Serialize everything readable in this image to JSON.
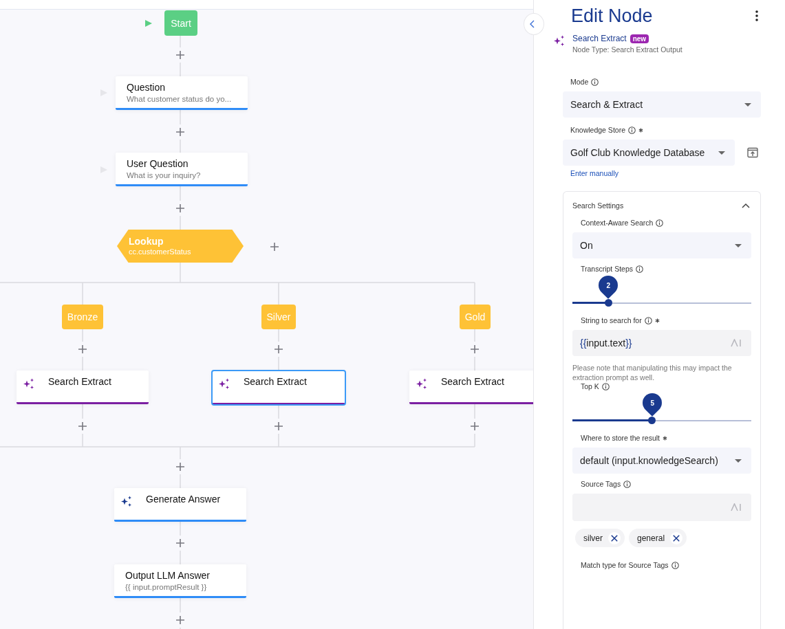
{
  "flow": {
    "nodes": [
      {
        "kind": "start",
        "label": "Start"
      },
      {
        "kind": "card",
        "title": "Question",
        "subtitle": "What customer status do yo...",
        "selected": false,
        "color": "#2f8cf7"
      },
      {
        "kind": "card",
        "title": "User Question",
        "subtitle": "What is your inquiry?",
        "selected": false,
        "color": "#2f8cf7"
      },
      {
        "kind": "lookup",
        "title": "Lookup",
        "subtitle": "cc.customerStatus"
      },
      {
        "kind": "branch",
        "label": "Bronze"
      },
      {
        "kind": "branch",
        "label": "Silver"
      },
      {
        "kind": "branch",
        "label": "Gold"
      },
      {
        "kind": "ai-card",
        "title": "Search Extract",
        "selected": false,
        "color": "#7b1fa2"
      },
      {
        "kind": "ai-card",
        "title": "Search Extract",
        "selected": true,
        "color": "#7b1fa2"
      },
      {
        "kind": "ai-card",
        "title": "Search Extract",
        "selected": false,
        "color": "#7b1fa2"
      },
      {
        "kind": "ai-card",
        "title": "Generate Answer",
        "selected": false,
        "color": "#2f8cf7"
      },
      {
        "kind": "card",
        "title": "Output LLM Answer",
        "subtitle": "{{ input.promptResult }}",
        "selected": false,
        "color": "#2f8cf7"
      }
    ]
  },
  "panel": {
    "title": "Edit Node",
    "node_name": "Search Extract",
    "badge": "new",
    "node_type": "Node Type: Search Extract Output",
    "mode": {
      "label": "Mode",
      "value": "Search & Extract"
    },
    "knowledge_store": {
      "label": "Knowledge Store",
      "required": true,
      "value": "Golf Club Knowledge Database",
      "link": "Enter manually"
    },
    "search_settings": {
      "title": "Search Settings",
      "expanded": true,
      "fields": [
        {
          "kind": "select",
          "label": "Context-Aware Search",
          "value": "On",
          "required": false
        },
        {
          "kind": "slider",
          "label": "Transcript Steps",
          "value_label": "2",
          "level": 0.2,
          "required": false
        },
        {
          "kind": "text",
          "label": "String to search for",
          "value": "{{input.text}}",
          "required": true,
          "note": "Please note that manipulating this may impact the extraction prompt as well."
        },
        {
          "kind": "slider",
          "label": "Top K",
          "value_label": "5",
          "level": 0.446,
          "required": false
        },
        {
          "kind": "select",
          "label": "Where to store the result",
          "value": "default (input.knowledgeSearch)",
          "required": true,
          "info": false
        },
        {
          "kind": "tags",
          "label": "Source Tags",
          "tags": [
            "silver",
            "general"
          ],
          "required": false
        },
        {
          "kind": "heading",
          "label": "Match type for Source Tags",
          "required": false
        }
      ]
    }
  }
}
